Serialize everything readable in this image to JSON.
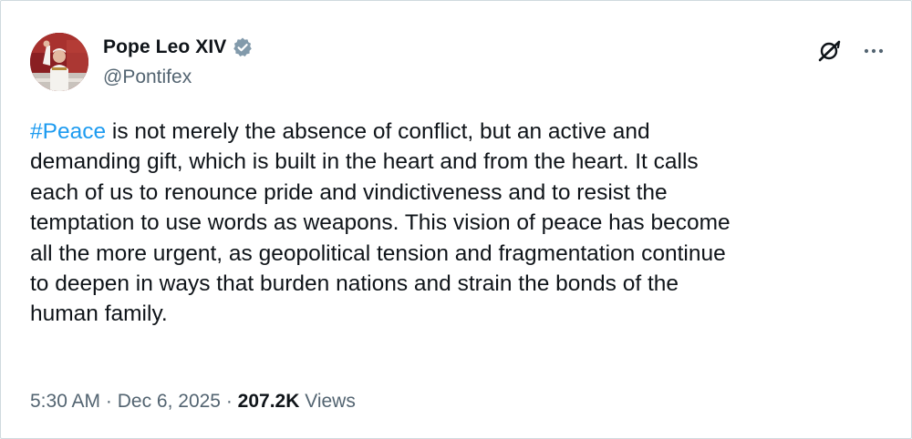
{
  "author": {
    "display_name": "Pope Leo XIV",
    "handle": "@Pontifex",
    "verified": true,
    "avatar_icon": "profile-photo"
  },
  "actions": {
    "grok_icon": "grok-icon",
    "more_icon": "more-options-icon"
  },
  "tweet": {
    "hashtag": "#Peace",
    "lines": [
      " is not merely the absence of conflict, but an active and",
      "demanding gift, which is built in the heart and from the heart. It calls",
      "each of us to renounce pride and vindictiveness and to resist the",
      "temptation to use words as weapons. This vision of peace has become",
      "all the more urgent, as geopolitical tension and fragmentation continue",
      "to deepen in ways that burden nations and strain the bonds of the",
      "human family."
    ]
  },
  "meta": {
    "time": "5:30 AM",
    "separator": " · ",
    "date": "Dec 6, 2025",
    "views_count": "207.2K",
    "views_label": " Views"
  },
  "colors": {
    "link": "#1d9bf0",
    "text": "#0f1419",
    "secondary": "#536471",
    "verified_badge": "#829aab"
  }
}
